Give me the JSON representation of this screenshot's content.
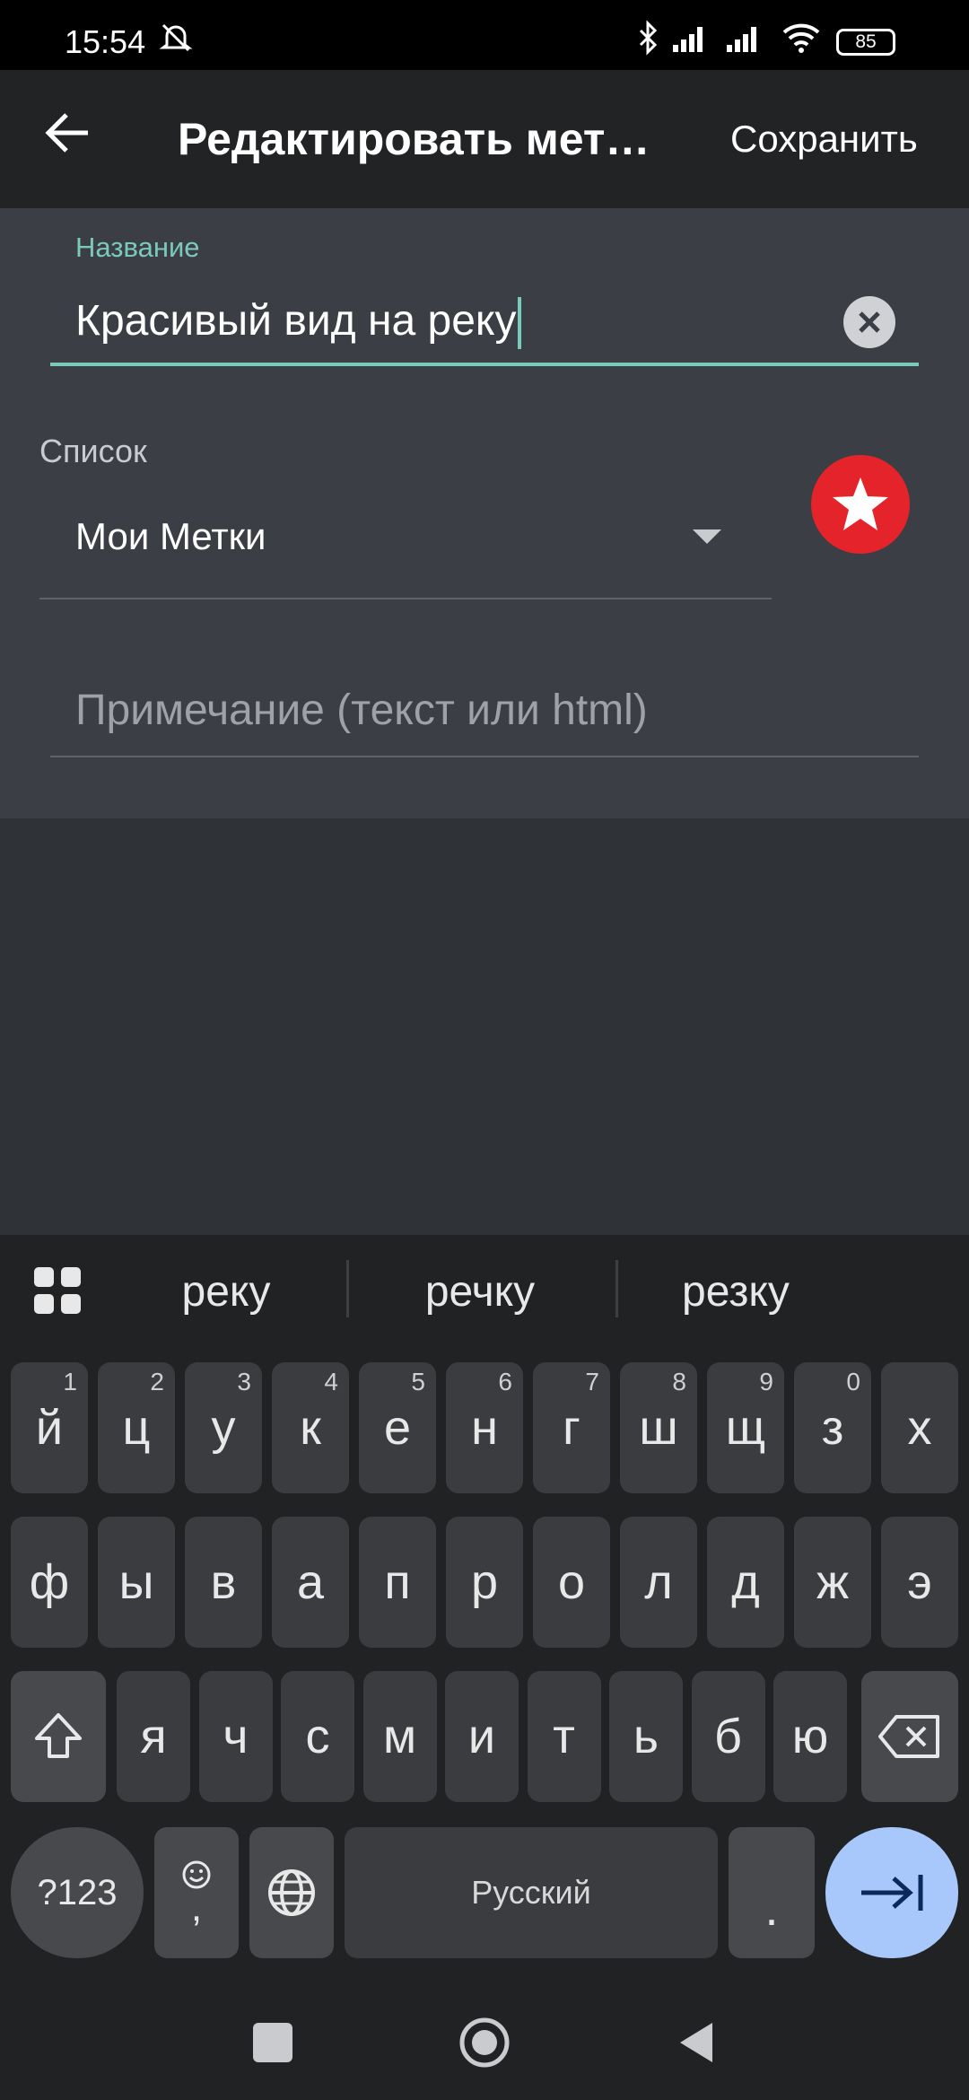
{
  "status_bar": {
    "time": "15:54",
    "battery": "85"
  },
  "app_bar": {
    "title": "Редактировать мет…",
    "save_label": "Сохранить"
  },
  "form": {
    "name_label": "Название",
    "name_value": "Красивый вид на реку",
    "list_label": "Список",
    "list_value": "Мои Метки",
    "note_placeholder": "Примечание (текст или html)"
  },
  "keyboard": {
    "suggestions": [
      "реку",
      "речку",
      "резку"
    ],
    "row1": [
      {
        "k": "й",
        "h": "1"
      },
      {
        "k": "ц",
        "h": "2"
      },
      {
        "k": "у",
        "h": "3"
      },
      {
        "k": "к",
        "h": "4"
      },
      {
        "k": "е",
        "h": "5"
      },
      {
        "k": "н",
        "h": "6"
      },
      {
        "k": "г",
        "h": "7"
      },
      {
        "k": "ш",
        "h": "8"
      },
      {
        "k": "щ",
        "h": "9"
      },
      {
        "k": "з",
        "h": "0"
      },
      {
        "k": "х",
        "h": ""
      }
    ],
    "row2": [
      "ф",
      "ы",
      "в",
      "а",
      "п",
      "р",
      "о",
      "л",
      "д",
      "ж",
      "э"
    ],
    "row3": [
      "я",
      "ч",
      "с",
      "м",
      "и",
      "т",
      "ь",
      "б",
      "ю"
    ],
    "symbols_label": "?123",
    "comma_label": ",",
    "space_label": "Русский",
    "period_label": "."
  },
  "colors": {
    "accent": "#7bc8bd",
    "star": "#e4232b",
    "enter_key": "#a8c7fa"
  }
}
